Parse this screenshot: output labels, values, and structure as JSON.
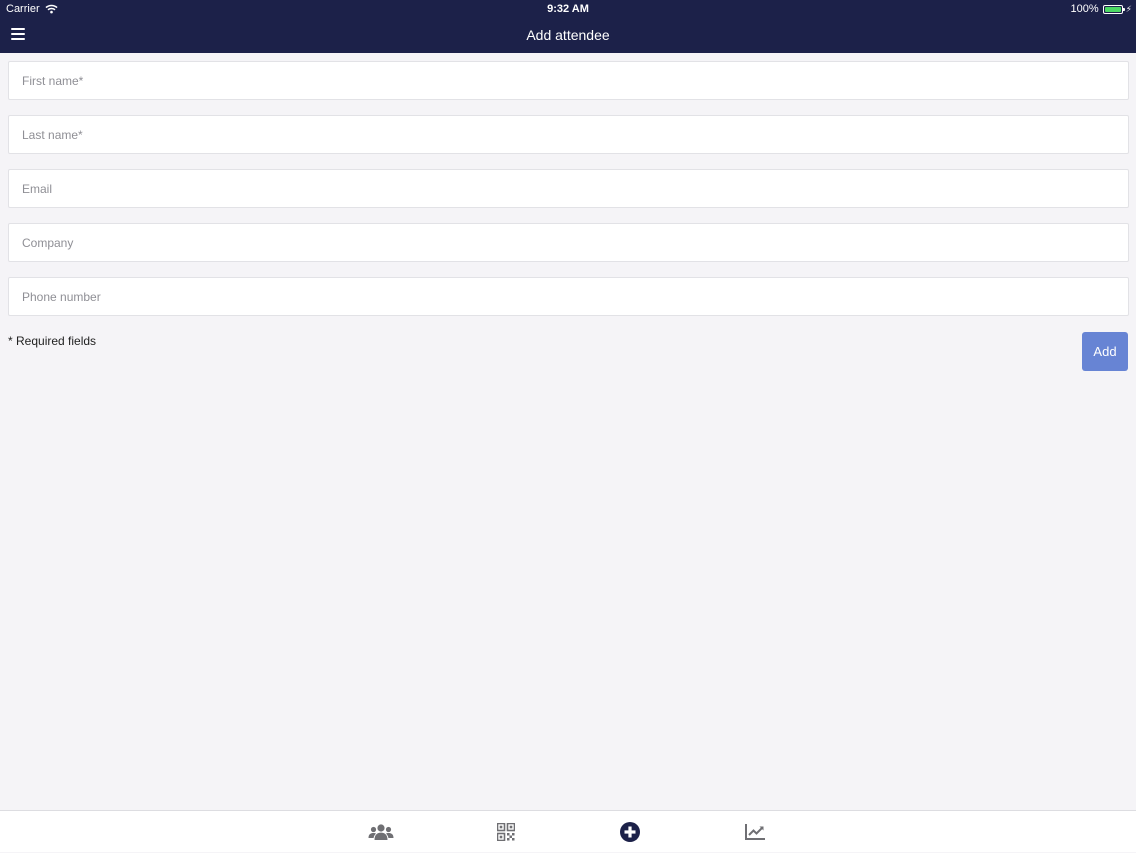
{
  "status": {
    "carrier": "Carrier",
    "time": "9:32 AM",
    "battery": "100%"
  },
  "nav": {
    "title": "Add attendee",
    "menu_icon": "hamburger-menu-icon"
  },
  "form": {
    "first_name": {
      "placeholder": "First name*",
      "value": ""
    },
    "last_name": {
      "placeholder": "Last name*",
      "value": ""
    },
    "email": {
      "placeholder": "Email",
      "value": ""
    },
    "company": {
      "placeholder": "Company",
      "value": ""
    },
    "phone": {
      "placeholder": "Phone number",
      "value": ""
    },
    "required_note": "* Required fields",
    "add_label": "Add"
  },
  "tabs": [
    {
      "icon": "attendees-group-icon",
      "active": false
    },
    {
      "icon": "qr-code-icon",
      "active": false
    },
    {
      "icon": "add-circle-icon",
      "active": true
    },
    {
      "icon": "stats-chart-icon",
      "active": false
    }
  ],
  "colors": {
    "header_bg": "#1c2149",
    "page_bg": "#f5f4f7",
    "button_bg": "#6784d4",
    "tab_active": "#1c2149",
    "tab_inactive": "#6f6f73",
    "battery_green": "#4cd964"
  }
}
